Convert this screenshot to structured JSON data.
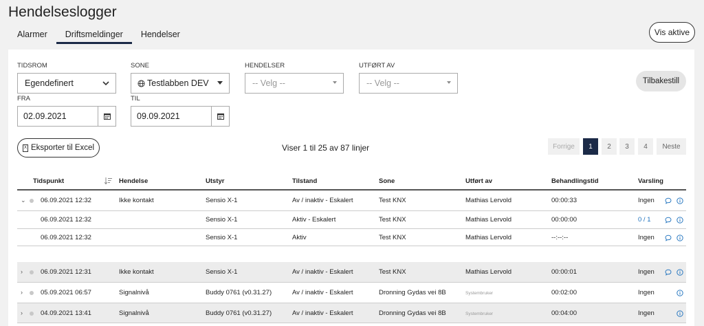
{
  "page_title": "Hendelseslogger",
  "tabs": [
    {
      "label": "Alarmer",
      "active": false
    },
    {
      "label": "Driftsmeldinger",
      "active": true
    },
    {
      "label": "Hendelser",
      "active": false
    }
  ],
  "vis_aktive_label": "Vis aktive",
  "filters": {
    "tidsrom": {
      "label": "TIDSROM",
      "value": "Egendefinert"
    },
    "sone": {
      "label": "SONE",
      "value": "Testlabben DEV"
    },
    "hendelser": {
      "label": "HENDELSER",
      "placeholder": "-- Velg --"
    },
    "utfort_av": {
      "label": "UTFØRT AV",
      "placeholder": "-- Velg --"
    },
    "fra": {
      "label": "FRA",
      "value": "02.09.2021"
    },
    "til": {
      "label": "TIL",
      "value": "09.09.2021"
    },
    "reset_label": "Tilbakestill"
  },
  "export_label": "Eksporter til Excel",
  "export_icon": "excel-file-icon",
  "result_info": "Viser 1 til 25 av 87 linjer",
  "pagination": {
    "prev": "Forrige",
    "pages": [
      "1",
      "2",
      "3",
      "4"
    ],
    "current": "1",
    "next": "Neste"
  },
  "columns": [
    "Tidspunkt",
    "Hendelse",
    "Utstyr",
    "Tilstand",
    "Sone",
    "Utført av",
    "Behandlingstid",
    "Varsling"
  ],
  "rows": [
    {
      "expand": "⌄",
      "dot": true,
      "tidspunkt": "06.09.2021 12:32",
      "hendelse": "Ikke kontakt",
      "utstyr": "Sensio X-1",
      "tilstand": "Av / inaktiv - Eskalert",
      "sone": "Test KNX",
      "utfort_av": "Mathias Lervold",
      "behandlingstid": "00:00:33",
      "varsling": "Ingen",
      "comment": true,
      "gray": false
    },
    {
      "expand": "",
      "dot": false,
      "tidspunkt": "06.09.2021 12:32",
      "hendelse": "",
      "utstyr": "Sensio X-1",
      "tilstand": "Aktiv - Eskalert",
      "sone": "Test KNX",
      "utfort_av": "Mathias Lervold",
      "behandlingstid": "00:00:00",
      "varsling": "0 / 1",
      "comment": true,
      "gray": false
    },
    {
      "expand": "",
      "dot": false,
      "tidspunkt": "06.09.2021 12:32",
      "hendelse": "",
      "utstyr": "Sensio X-1",
      "tilstand": "Aktiv",
      "sone": "Test KNX",
      "utfort_av": "Mathias Lervold",
      "behandlingstid": "--:--:--",
      "varsling": "Ingen",
      "comment": true,
      "gray": false
    },
    {
      "expand": "›",
      "dot": true,
      "tidspunkt": "06.09.2021 12:31",
      "hendelse": "Ikke kontakt",
      "utstyr": "Sensio X-1",
      "tilstand": "Av / inaktiv - Eskalert",
      "sone": "Test KNX",
      "utfort_av": "Mathias Lervold",
      "behandlingstid": "00:00:01",
      "varsling": "Ingen",
      "comment": true,
      "gray": true
    },
    {
      "expand": "›",
      "dot": true,
      "tidspunkt": "05.09.2021 06:57",
      "hendelse": "Signalnivå",
      "utstyr": "Buddy 0761 (v0.31.27)",
      "tilstand": "Av / inaktiv - Eskalert",
      "sone": "Dronning Gydas vei 8B",
      "utfort_av": "Systembruker",
      "behandlingstid": "00:02:00",
      "varsling": "Ingen",
      "comment": false,
      "gray": false
    },
    {
      "expand": "›",
      "dot": true,
      "tidspunkt": "04.09.2021 13:41",
      "hendelse": "Signalnivå",
      "utstyr": "Buddy 0761 (v0.31.27)",
      "tilstand": "Av / inaktiv - Eskalert",
      "sone": "Dronning Gydas vei 8B",
      "utfort_av": "Systembruker",
      "behandlingstid": "00:04:00",
      "varsling": "Ingen",
      "comment": false,
      "gray": true
    }
  ],
  "colors": {
    "accent": "#1b2a47",
    "link": "#1a6fbd"
  }
}
